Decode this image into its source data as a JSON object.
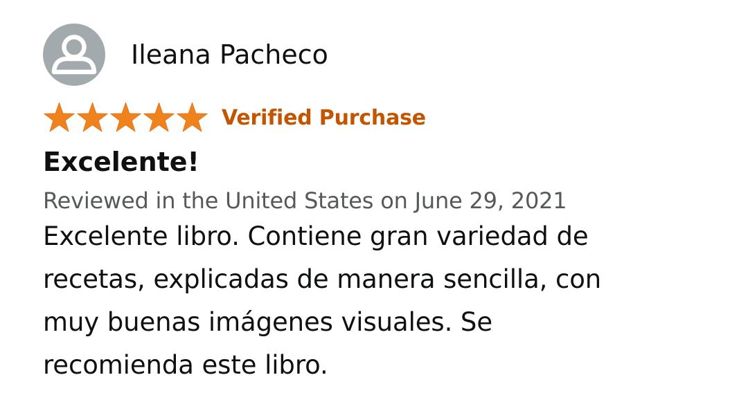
{
  "reviewer": {
    "name": "Ileana Pacheco",
    "avatar_icon": "default-user-avatar-icon"
  },
  "rating": {
    "value": 5,
    "max": 5,
    "star_color": "#f0821e",
    "star_icon": "star-icon"
  },
  "badge": {
    "label": "Verified Purchase",
    "color": "#c45500"
  },
  "review": {
    "title": "Excelente!",
    "date_line": "Reviewed in the United States on June 29, 2021",
    "body_lines": [
      "Excelente libro. Contiene gran variedad de",
      "recetas, explicadas de manera sencilla, con",
      "muy buenas imágenes visuales. Se",
      "recomienda este libro."
    ]
  },
  "colors": {
    "text_primary": "#0f1111",
    "text_secondary": "#565959",
    "avatar_bg": "#a3aaad"
  }
}
